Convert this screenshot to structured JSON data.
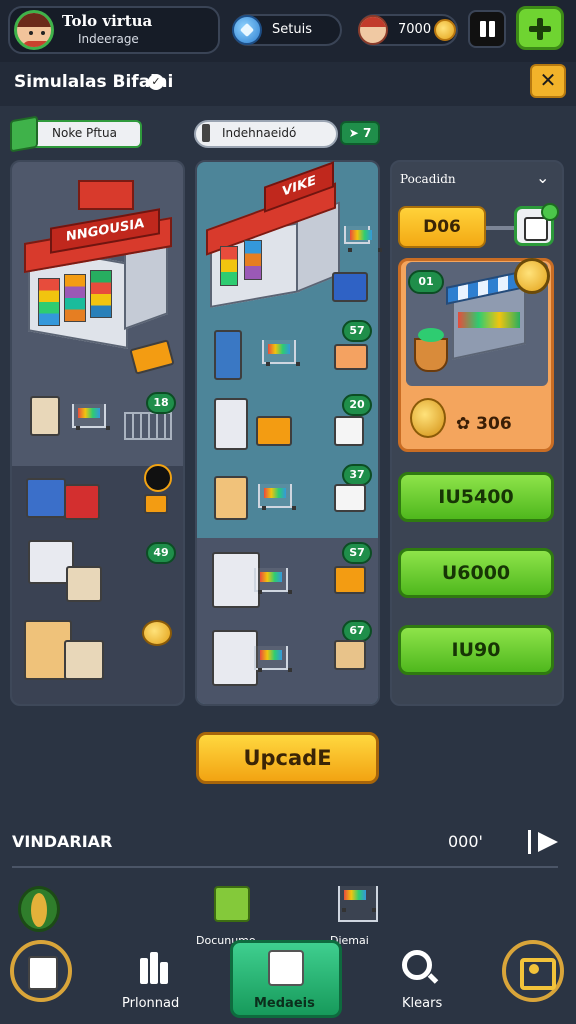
{
  "header": {
    "player_name": "Tolo virtua",
    "player_sub": "Indeerage",
    "resources": [
      {
        "id": "gems",
        "label": "Setuis"
      },
      {
        "id": "coins",
        "label": "7000"
      }
    ]
  },
  "title_row": {
    "title": "Simulalas Bifaiai"
  },
  "filters": {
    "left_label": "Noke Pftua",
    "mid_label": "Indehnaeidó",
    "badge": "7"
  },
  "panel_left": {
    "store_sign": "NNGOUSIA",
    "badges": [
      "18",
      "49"
    ]
  },
  "panel_mid": {
    "store_sign": "VIKE",
    "badges": [
      "57",
      "20",
      "37",
      "S7",
      "67"
    ]
  },
  "panel_right": {
    "header": "Pocadidn",
    "pill_value": "D06",
    "card_badge": "01",
    "card_value": "306",
    "buttons": [
      "IU5400",
      "U6000",
      "IU90"
    ]
  },
  "upgrade": {
    "label": "UpcadE"
  },
  "inventory": {
    "label": "VINDARIAR",
    "value": "000'"
  },
  "categories": [
    {
      "label": "Docunumo"
    },
    {
      "label": "Diemai"
    }
  ],
  "nav": [
    {
      "label": "Prlonnad"
    },
    {
      "label": "Medaeis"
    },
    {
      "label": "Klears"
    }
  ],
  "colors": {
    "background": "#2b3443",
    "accent_green": "#6fd431",
    "accent_yellow": "#f2a312",
    "accent_orange": "#f4a55d"
  }
}
